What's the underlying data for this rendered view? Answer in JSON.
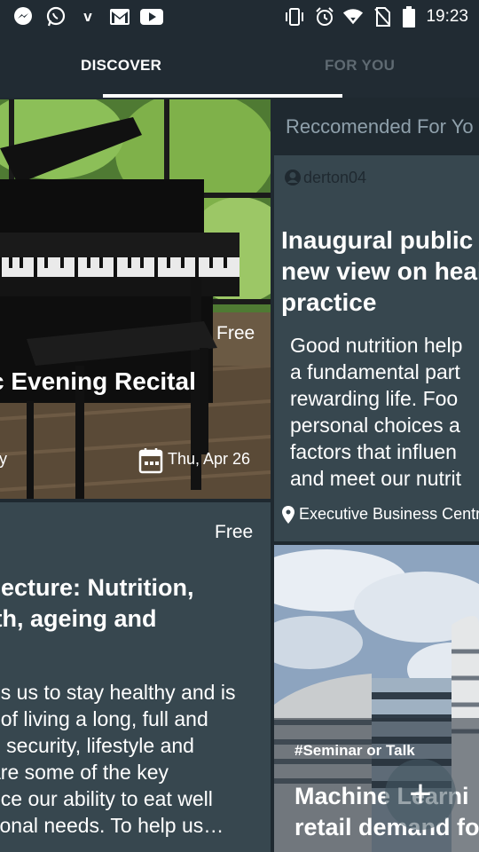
{
  "status_bar": {
    "time": "19:23",
    "left_icons": [
      "messenger-icon",
      "whatsapp-icon",
      "v-icon",
      "gmail-icon",
      "youtube-icon"
    ],
    "v_label": "v",
    "right_icons": [
      "vibrate-icon",
      "alarm-icon",
      "wifi-icon",
      "no-sim-icon",
      "battery-icon"
    ]
  },
  "tabs": [
    {
      "label": "DISCOVER",
      "selected": true
    },
    {
      "label": "FOR YOU",
      "selected": false
    }
  ],
  "discover": {
    "card1": {
      "price": "Free",
      "title": "c Evening Recital",
      "subtitle": "ty",
      "date": "Thu, Apr 26"
    },
    "card2": {
      "price": "Free",
      "title": " lecture: Nutrition,\nlth, ageing and",
      "body": "ps us to stay healthy and is\nt of living a long, full and\nd security, lifestyle and\nare some of the key\nnce our ability to eat well\ntional needs. To help us…"
    }
  },
  "for_you": {
    "header": "Reccomended For Yo",
    "card1": {
      "user": "derton04",
      "title": "Inaugural public\nnew view on heal\npractice",
      "body": "Good nutrition help\na fundamental part\nrewarding life. Foo\npersonal choices a\nfactors that influen\nand meet our nutrit",
      "location": "Executive Business Centr"
    },
    "card2": {
      "tag": "#Seminar or Talk",
      "title": "Machine Learni\nretail demand fo"
    }
  },
  "fab": {
    "label": "+"
  },
  "colors": {
    "background": "#1f2930",
    "card": "#37474f",
    "tab_inactive": "#5f6a72",
    "accent": "#ffffff"
  }
}
